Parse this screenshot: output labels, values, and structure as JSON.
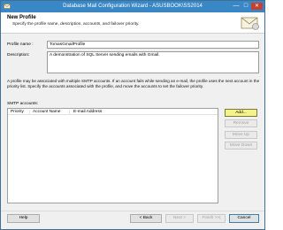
{
  "window": {
    "title": "Database Mail Configuration Wizard - ASUSBOOK\\SS2014",
    "minimize_glyph": "—",
    "maximize_glyph": "□",
    "close_glyph": "✕"
  },
  "header": {
    "title": "New Profile",
    "subtitle": "Specify the profile name, description, accounts, and failover priority."
  },
  "form": {
    "profile_name_label": "Profile name :",
    "profile_name_value": "TomasGmailProfile",
    "description_label": "Description:",
    "description_value": "A demonstration of SQL Server sending emails with Gmail."
  },
  "info_text": "A profile may be associated with multiple SMTP accounts. If an account fails while sending an e-mail, the profile uses the next account in the priority list. Specify the accounts associated with the profile, and move the accounts to set the failover priority.",
  "accounts": {
    "label": "SMTP accounts:",
    "columns": [
      "Priority",
      "Account Name",
      "E-mail Address"
    ],
    "rows": []
  },
  "side_buttons": {
    "add": "Add...",
    "remove": "Remove",
    "move_up": "Move Up",
    "move_down": "Move Down"
  },
  "footer": {
    "help": "Help",
    "back": "< Back",
    "next": "Next >",
    "finish": "Finish >>|",
    "cancel": "Cancel"
  },
  "colors": {
    "titlebar": "#3a87c6",
    "close_button": "#c84031",
    "add_highlight": "#f3f38a"
  },
  "icons": {
    "app": "database-mail-icon",
    "header_logo": "mail-envelope-icon"
  }
}
